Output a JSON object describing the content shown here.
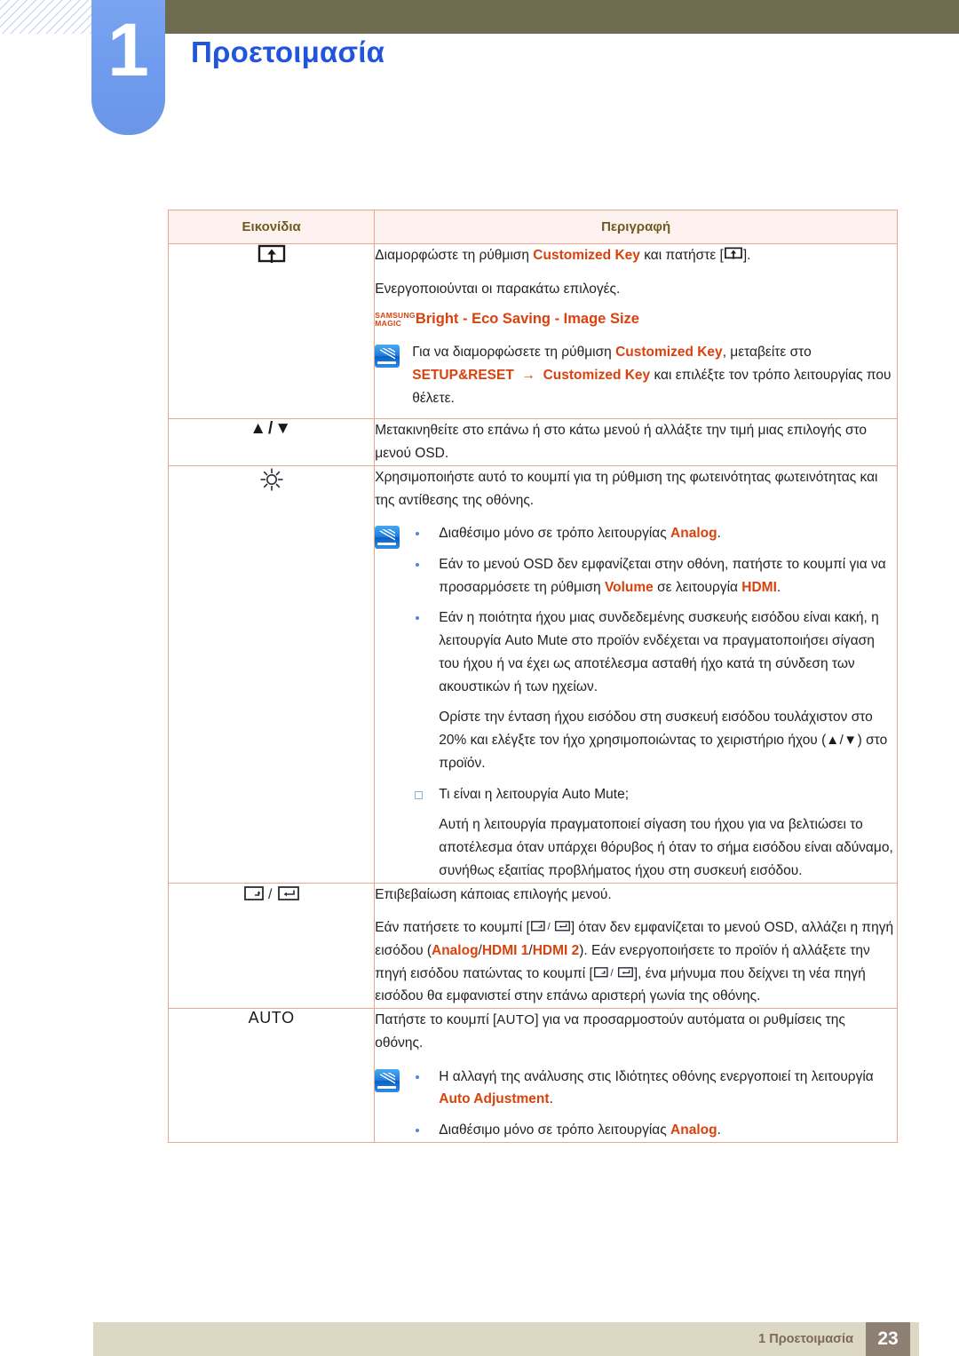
{
  "header": {
    "chapter_number": "1",
    "chapter_title": "Προετοιμασία"
  },
  "table": {
    "columns": {
      "icons": "Εικονίδια",
      "description": "Περιγραφή"
    },
    "rows": [
      {
        "icon_name": "customized-key-icon",
        "icon_label": "",
        "desc": {
          "p1_a": "Διαμορφώστε τη ρύθμιση ",
          "p1_hl": "Customized Key",
          "p1_b": " και πατήστε [",
          "p1_c": "].",
          "p2": "Ενεργοποιούνται οι παρακάτω επιλογές.",
          "magic_top": "SAMSUNG",
          "magic_bottom": "MAGIC",
          "magic_items": "Bright - Eco Saving - Image Size",
          "note_a": "Για να διαμορφώσετε τη ρύθμιση ",
          "note_hl1": "Customized Key",
          "note_b": ", μεταβείτε στο ",
          "note_hl2": "SETUP&RESET",
          "note_arrow": "→",
          "note_hl3": "Customized Key",
          "note_c": " και επιλέξτε τον τρόπο λειτουργίας που θέλετε."
        }
      },
      {
        "icon_name": "up-down-arrows-icon",
        "icon_label": "▲/▼",
        "desc": {
          "p1": "Μετακινηθείτε στο επάνω ή στο κάτω μενού ή αλλάξτε την τιμή μιας επιλογής στο μενού OSD."
        }
      },
      {
        "icon_name": "brightness-sun-icon",
        "icon_label": "☼",
        "desc": {
          "p1": "Χρησιμοποιήστε αυτό το κουμπί για τη ρύθμιση της φωτεινότητας φωτεινότητας και της αντίθεσης της οθόνης.",
          "b1_a": "Διαθέσιμο μόνο σε τρόπο λειτουργίας ",
          "b1_hl": "Analog",
          "b1_b": ".",
          "b2_a": "Εάν το μενού OSD δεν εμφανίζεται στην οθόνη, πατήστε το κουμπί για να προσαρμόσετε τη ρύθμιση ",
          "b2_hl1": "Volume",
          "b2_b": " σε λειτουργία ",
          "b2_hl2": "HDMI",
          "b2_c": ".",
          "b3": "Εάν η ποιότητα ήχου μιας συνδεδεμένης συσκευής εισόδου είναι κακή, η λειτουργία Auto Mute στο προϊόν ενδέχεται να πραγματοποιήσει σίγαση του ήχου ή να έχει ως αποτέλεσμα ασταθή ήχο κατά τη σύνδεση των ακουστικών ή των ηχείων.",
          "b3_sub_a": "Ορίστε την ένταση ήχου εισόδου στη συσκευή εισόδου τουλάχιστον στο 20% και ελέγξτε τον ήχο χρησιμοποιώντας το χειριστήριο ήχου (",
          "b3_sub_icon": "▲/▼",
          "b3_sub_b": ") στο προϊόν.",
          "b4": "Τι είναι η λειτουργία Auto Mute;",
          "b4_sub": "Αυτή η λειτουργία πραγματοποιεί σίγαση του ήχου για να βελτιώσει το αποτέλεσμα όταν υπάρχει θόρυβος ή όταν το σήμα εισόδου είναι αδύναμο, συνήθως εξαιτίας προβλήματος ήχου στη συσκευή εισόδου."
        }
      },
      {
        "icon_name": "source-enter-icon",
        "icon_label": "",
        "desc": {
          "p1": "Επιβεβαίωση κάποιας επιλογής μενού.",
          "p2_a": "Εάν πατήσετε το κουμπί [",
          "p2_b": "] όταν δεν εμφανίζεται το μενού OSD, αλλάζει η πηγή εισόδου (",
          "p2_hl1": "Analog",
          "p2_slash1": "/",
          "p2_hl2": "HDMI 1",
          "p2_slash2": "/",
          "p2_hl3": "HDMI 2",
          "p2_c": "). Εάν ενεργοποιήσετε το προϊόν ή αλλάξετε την πηγή εισόδου πατώντας το κουμπί [",
          "p2_d": "], ένα μήνυμα που δείχνει τη νέα πηγή εισόδου θα εμφανιστεί στην επάνω αριστερή γωνία της οθόνης."
        }
      },
      {
        "icon_name": "auto-button-icon",
        "icon_label": "AUTO",
        "desc": {
          "p1_a": "Πατήστε το κουμπί [",
          "p1_key": "AUTO",
          "p1_b": "] για να προσαρμοστούν αυτόματα οι ρυθμίσεις της οθόνης.",
          "b1_a": "Η αλλαγή της ανάλυσης στις Ιδιότητες οθόνης ενεργοποιεί τη λειτουργία ",
          "b1_hl": "Auto Adjustment",
          "b1_b": ".",
          "b2_a": "Διαθέσιμο μόνο σε τρόπο λειτουργίας ",
          "b2_hl": "Analog",
          "b2_b": "."
        }
      }
    ]
  },
  "footer": {
    "chapter_label": "1 Προετοιμασία",
    "page_number": "23"
  },
  "colors": {
    "accent_orange": "#d9410d",
    "title_blue": "#2255dd",
    "olive": "#6f6b51",
    "footer_bg": "#ddd8c4",
    "page_box": "#8d7f72"
  }
}
